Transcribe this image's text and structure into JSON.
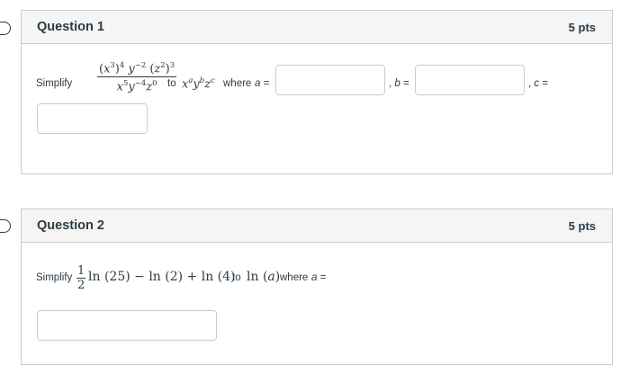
{
  "questions": [
    {
      "title": "Question 1",
      "points": "5 pts",
      "prompt_prefix": "Simplify",
      "numerator": "(x³)⁴ y⁻² (z²)³",
      "denominator": "x⁵ y⁻⁴ z⁰",
      "mid_text": "to",
      "target": "xᵃ yᵇ zᶜ",
      "where_text": "where",
      "labels": {
        "a": "a =",
        "b": ", b =",
        "c": ", c ="
      },
      "answers": {
        "a": "",
        "b": "",
        "c": ""
      }
    },
    {
      "title": "Question 2",
      "points": "5 pts",
      "prompt_prefix": "Simplify",
      "expression": "½ ln(25) − ln(2) + ln(4)",
      "mid_text": "to",
      "target": "ln(a)",
      "where_text": "where",
      "labels": {
        "a": "a ="
      },
      "answers": {
        "a": ""
      }
    }
  ]
}
